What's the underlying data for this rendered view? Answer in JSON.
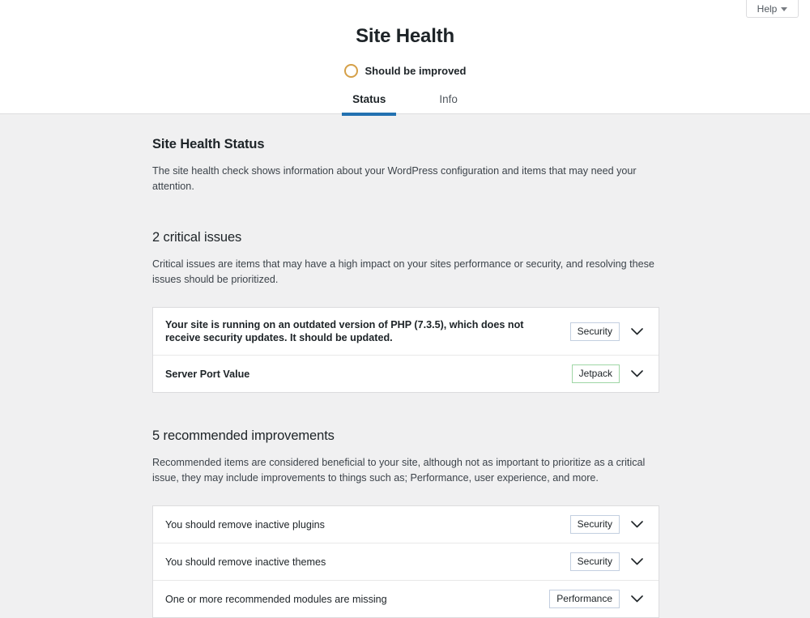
{
  "help": {
    "label": "Help",
    "icon": "caret-down-icon"
  },
  "header": {
    "title": "Site Health",
    "status_label": "Should be improved",
    "status_ring_color": "#d5a048",
    "tabs": [
      {
        "label": "Status",
        "active": true
      },
      {
        "label": "Info",
        "active": false
      }
    ],
    "active_tab_color": "#2271b1"
  },
  "main": {
    "section_title": "Site Health Status",
    "section_desc": "The site health check shows information about your WordPress configuration and items that may need your attention.",
    "critical": {
      "heading": "2 critical issues",
      "desc": "Critical issues are items that may have a high impact on your sites performance or security, and resolving these issues should be prioritized.",
      "items": [
        {
          "text": "Your site is running on an outdated version of PHP (7.3.5), which does not receive security updates. It should be updated.",
          "badge": "Security",
          "badge_color": "#c3cfe0",
          "bold": true
        },
        {
          "text": "Server Port Value",
          "badge": "Jetpack",
          "badge_color": "#9fd6a5",
          "bold": true
        }
      ]
    },
    "recommended": {
      "heading": "5 recommended improvements",
      "desc": "Recommended items are considered beneficial to your site, although not as important to prioritize as a critical issue, they may include improvements to things such as; Performance, user experience, and more.",
      "items": [
        {
          "text": "You should remove inactive plugins",
          "badge": "Security",
          "badge_color": "#c3cfe0",
          "bold": false
        },
        {
          "text": "You should remove inactive themes",
          "badge": "Security",
          "badge_color": "#c3cfe0",
          "bold": false
        },
        {
          "text": "One or more recommended modules are missing",
          "badge": "Performance",
          "badge_color": "#c3cfe0",
          "bold": false
        }
      ]
    }
  }
}
